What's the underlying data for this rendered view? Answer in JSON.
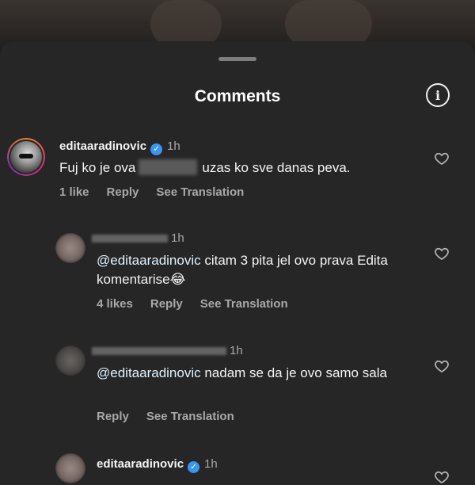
{
  "sheet": {
    "title": "Comments"
  },
  "comments": [
    {
      "username": "editaaradinovic",
      "verified": true,
      "time": "1h",
      "text_before": "Fuj ko je ova",
      "text_after": "uzas ko sve danas peva.",
      "likes": "1 like",
      "reply": "Reply",
      "translate": "See Translation"
    },
    {
      "username": "",
      "time": "1h",
      "mention": "@editaaradinovic",
      "text": "citam 3 pita jel ovo prava Edita komentarise😂",
      "likes": "4 likes",
      "reply": "Reply",
      "translate": "See Translation"
    },
    {
      "username": "",
      "time": "1h",
      "mention": "@editaaradinovic",
      "text": "nadam se da je ovo samo sala",
      "reply": "Reply",
      "translate": "See Translation"
    },
    {
      "username": "editaaradinovic",
      "verified": true,
      "time": "1h"
    }
  ]
}
